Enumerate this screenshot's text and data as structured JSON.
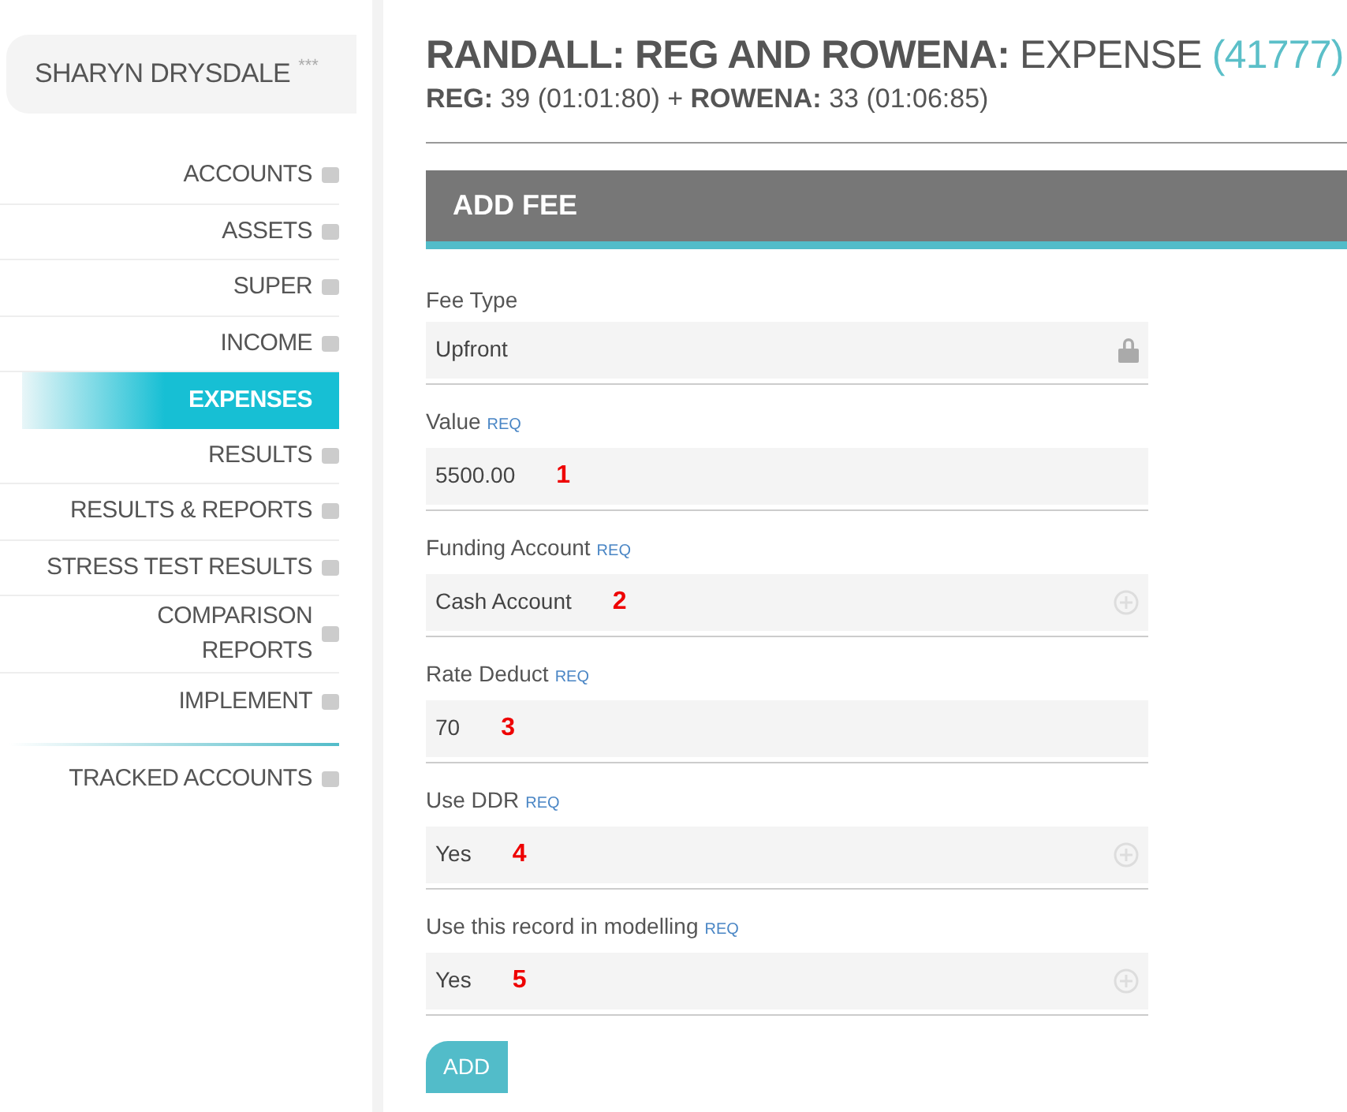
{
  "sidebar": {
    "user": {
      "name": "SHARYN DRYSDALE",
      "stars": "***"
    },
    "items": [
      {
        "label": "ACCOUNTS",
        "selected": false
      },
      {
        "label": "ASSETS",
        "selected": false
      },
      {
        "label": "SUPER",
        "selected": false
      },
      {
        "label": "INCOME",
        "selected": false
      },
      {
        "label": "EXPENSES",
        "selected": true
      },
      {
        "label": "RESULTS",
        "selected": false
      },
      {
        "label": "RESULTS & REPORTS",
        "selected": false
      },
      {
        "label": "STRESS TEST RESULTS",
        "selected": false
      },
      {
        "label": "COMPARISON REPORTS",
        "selected": false
      },
      {
        "label": "IMPLEMENT",
        "selected": false
      }
    ],
    "extra_items": [
      {
        "label": "TRACKED ACCOUNTS",
        "selected": false
      }
    ]
  },
  "header": {
    "title": "**RANDALL: REG AND ROWENA:** EXPENSE",
    "record_id": "(41777)",
    "subtitle": "**REG:** 39 (01:01:80) + **ROWENA:** 33 (01:06:85)"
  },
  "panel": {
    "title": "ADD FEE",
    "fields": [
      {
        "label": "Fee Type",
        "required": false,
        "value": "Upfront",
        "kind": "locked"
      },
      {
        "label": "Value",
        "required": true,
        "req_text": "REQ",
        "value": "5500.00",
        "annotation": "1",
        "kind": "text"
      },
      {
        "label": "Funding Account",
        "required": true,
        "req_text": "REQ",
        "value": "Cash Account",
        "annotation": "2",
        "kind": "select"
      },
      {
        "label": "Rate Deduct",
        "required": true,
        "req_text": "REQ",
        "value": "70",
        "annotation": "3",
        "kind": "text"
      },
      {
        "label": "Use DDR",
        "required": true,
        "req_text": "REQ",
        "value": "Yes",
        "annotation": "4",
        "kind": "select"
      },
      {
        "label": "Use this record in modelling",
        "required": true,
        "req_text": "REQ",
        "value": "Yes",
        "annotation": "5",
        "kind": "select"
      }
    ],
    "button": "ADD"
  }
}
